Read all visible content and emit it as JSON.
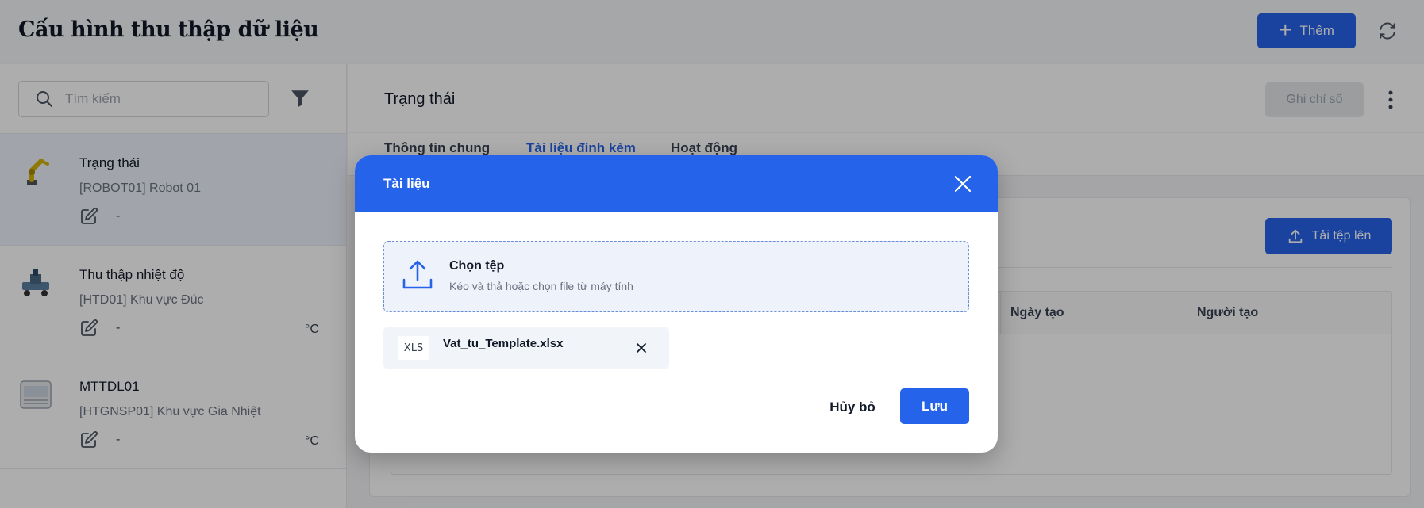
{
  "header": {
    "title": "Cấu hình thu thập dữ liệu",
    "add_label": "Thêm"
  },
  "sidebar": {
    "search_placeholder": "Tìm kiếm",
    "items": [
      {
        "name": "Trạng thái",
        "code": "[ROBOT01] Robot 01",
        "value": "-",
        "unit": "",
        "thumb": "robot-arm-icon",
        "active": true
      },
      {
        "name": "Thu thập nhiệt độ",
        "code": "[HTD01] Khu vực Đúc",
        "value": "-",
        "unit": "°C",
        "thumb": "machine-icon",
        "active": false
      },
      {
        "name": "MTTDL01",
        "code": "[HTGNSP01] Khu vực Gia Nhiệt",
        "value": "-",
        "unit": "°C",
        "thumb": "oven-icon",
        "active": false
      }
    ]
  },
  "main": {
    "title": "Trạng thái",
    "record_label": "Ghi chỉ số",
    "tabs": [
      {
        "label": "Thông tin chung"
      },
      {
        "label": "Tài liệu đính kèm"
      },
      {
        "label": "Hoạt động"
      }
    ],
    "upload_label": "Tải tệp lên",
    "columns": [
      "Ngày tạo",
      "Người tạo"
    ]
  },
  "modal": {
    "title": "Tài liệu",
    "dropzone_title": "Chọn tệp",
    "dropzone_subtitle": "Kéo và thả hoặc chọn file từ máy tính",
    "file": {
      "type": "XLS",
      "name": "Vat_tu_Template.xlsx"
    },
    "cancel_label": "Hủy bỏ",
    "save_label": "Lưu"
  },
  "colors": {
    "primary": "#2563eb",
    "overlay": "rgba(0,0,0,0.32)"
  }
}
